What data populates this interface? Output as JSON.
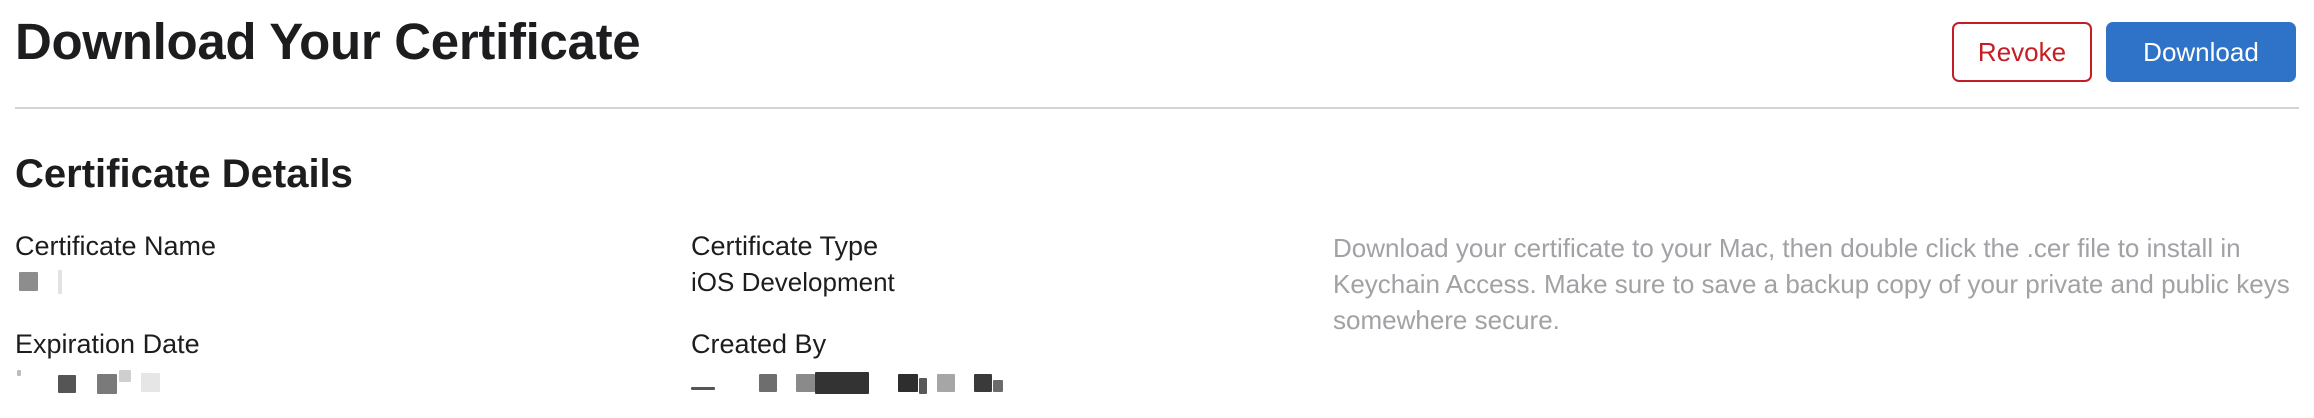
{
  "header": {
    "title": "Download Your Certificate",
    "revoke_label": "Revoke",
    "download_label": "Download"
  },
  "details": {
    "title": "Certificate Details",
    "certificate_name": {
      "label": "Certificate Name",
      "value": ""
    },
    "certificate_type": {
      "label": "Certificate Type",
      "value": "iOS Development"
    },
    "expiration_date": {
      "label": "Expiration Date",
      "value": ""
    },
    "created_by": {
      "label": "Created By",
      "value": ""
    },
    "help_text": "Download your certificate to your Mac, then double click the .cer file to install in Keychain Access. Make sure to save a backup copy of your private and public keys somewhere secure."
  },
  "colors": {
    "revoke": "#c41e24",
    "download_button": "#2f73c9",
    "help_text": "#a1a1a6",
    "divider": "#d2d2d7"
  }
}
